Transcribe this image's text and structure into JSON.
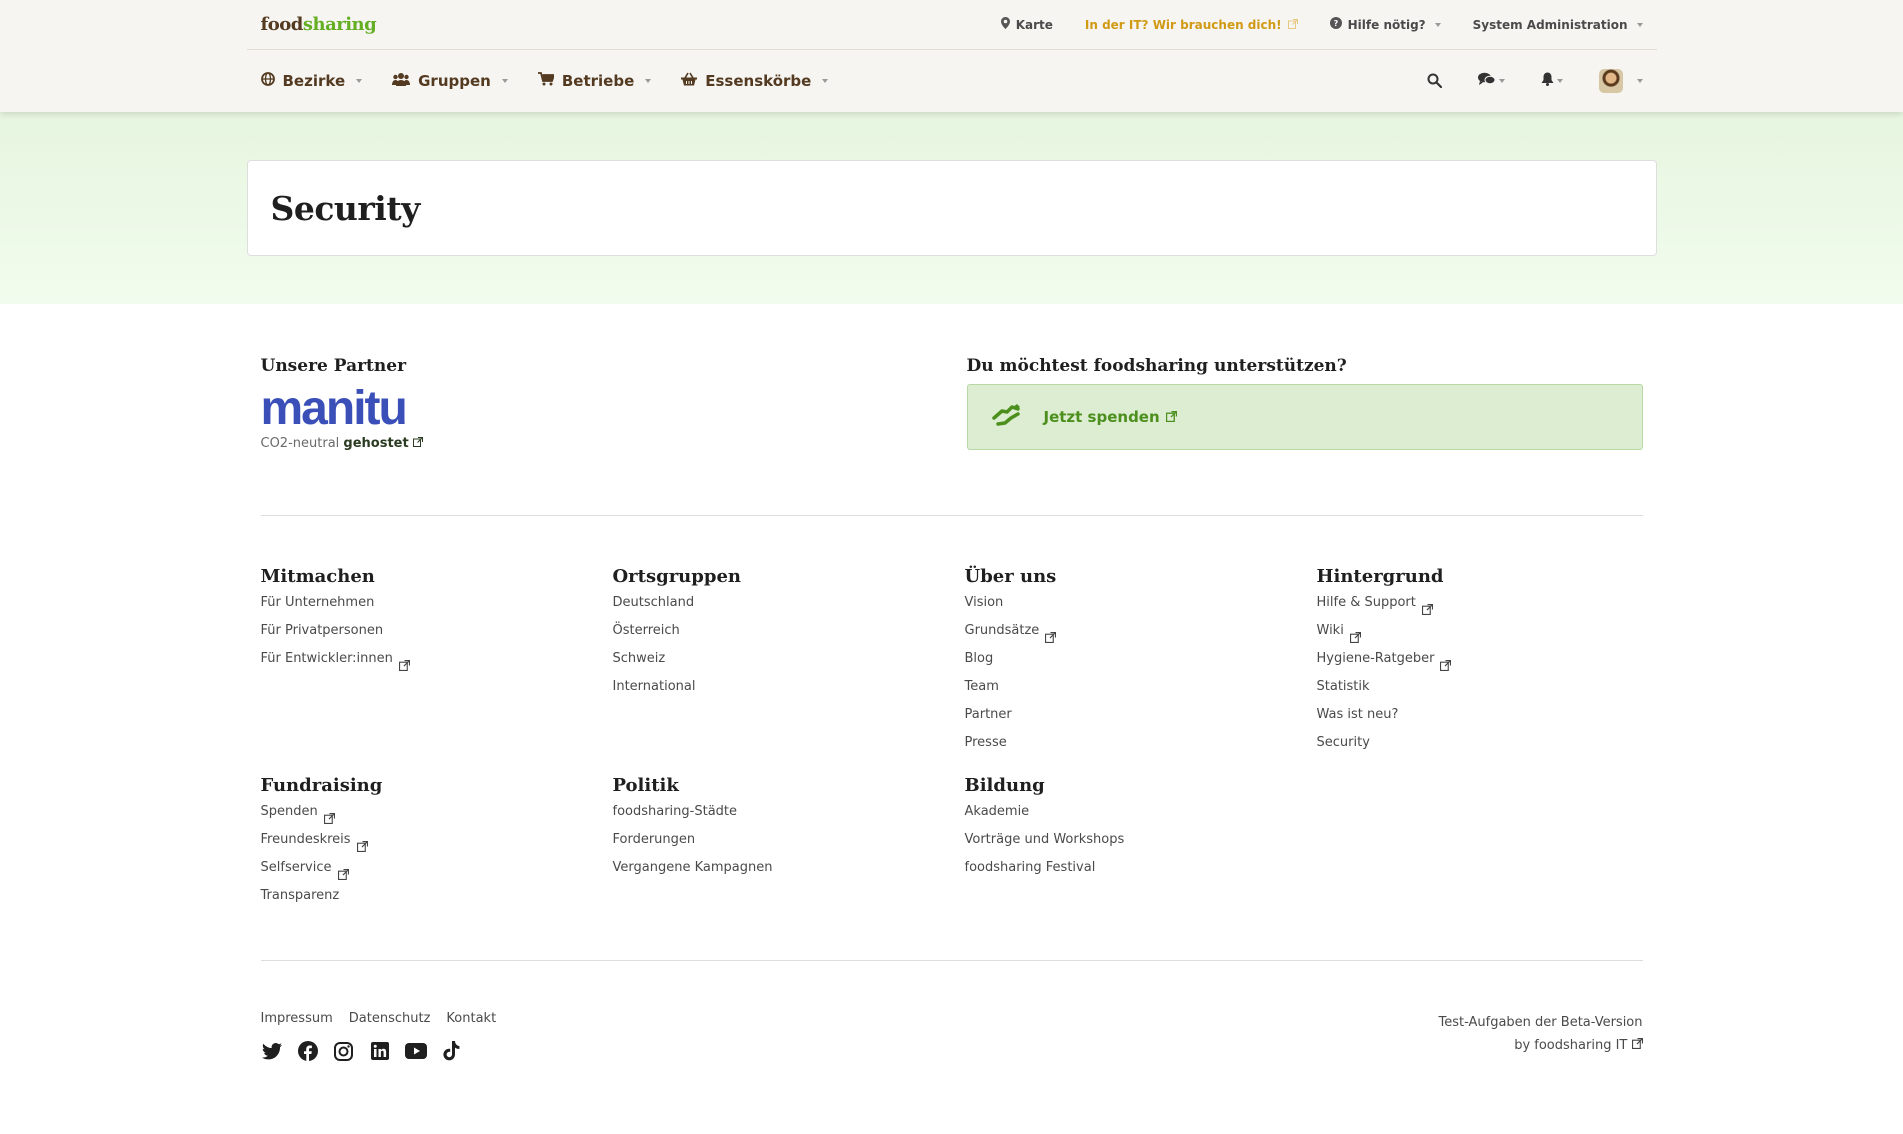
{
  "brand": {
    "food": "food",
    "sharing": "sharing"
  },
  "topbar": {
    "map": "Karte",
    "it": "In der IT? Wir brauchen dich!",
    "help": "Hilfe nötig?",
    "admin": "System Administration"
  },
  "nav": {
    "items": [
      {
        "label": "Bezirke",
        "icon": "globe-icon"
      },
      {
        "label": "Gruppen",
        "icon": "users-icon"
      },
      {
        "label": "Betriebe",
        "icon": "cart-icon"
      },
      {
        "label": "Essenskörbe",
        "icon": "basket-icon"
      }
    ]
  },
  "page": {
    "title": "Security"
  },
  "partners": {
    "heading": "Unsere Partner",
    "logo": "manitu",
    "co2": "CO2-neutral",
    "hosted": "gehostet"
  },
  "support": {
    "heading": "Du möchtest foodsharing unterstützen?",
    "donate": "Jetzt spenden"
  },
  "footer": {
    "mitmachen": {
      "title": "Mitmachen",
      "items": [
        "Für Unternehmen",
        "Für Privatpersonen",
        "Für Entwickler:innen"
      ]
    },
    "ortsgruppen": {
      "title": "Ortsgruppen",
      "items": [
        "Deutschland",
        "Österreich",
        "Schweiz",
        "International"
      ]
    },
    "ueber": {
      "title": "Über uns",
      "items": [
        "Vision",
        "Grundsätze",
        "Blog",
        "Team",
        "Partner",
        "Presse"
      ]
    },
    "hintergrund": {
      "title": "Hintergrund",
      "items": [
        "Hilfe & Support",
        "Wiki",
        "Hygiene-Ratgeber",
        "Statistik",
        "Was ist neu?",
        "Security"
      ]
    },
    "fundraising": {
      "title": "Fundraising",
      "items": [
        "Spenden",
        "Freundeskreis",
        "Selfservice",
        "Transparenz"
      ]
    },
    "politik": {
      "title": "Politik",
      "items": [
        "foodsharing-Städte",
        "Forderungen",
        "Vergangene Kampagnen"
      ]
    },
    "bildung": {
      "title": "Bildung",
      "items": [
        "Akademie",
        "Vorträge und Workshops",
        "foodsharing Festival"
      ]
    }
  },
  "legal": {
    "impressum": "Impressum",
    "datenschutz": "Datenschutz",
    "kontakt": "Kontakt"
  },
  "beta": {
    "line1": "Test-Aufgaben der Beta-Version",
    "line2": "by foodsharing IT"
  },
  "colors": {
    "brand_brown": "#533a20",
    "brand_green": "#64ae24",
    "accent_orange": "#d19a15",
    "manitu_blue": "#3b4fb8"
  }
}
